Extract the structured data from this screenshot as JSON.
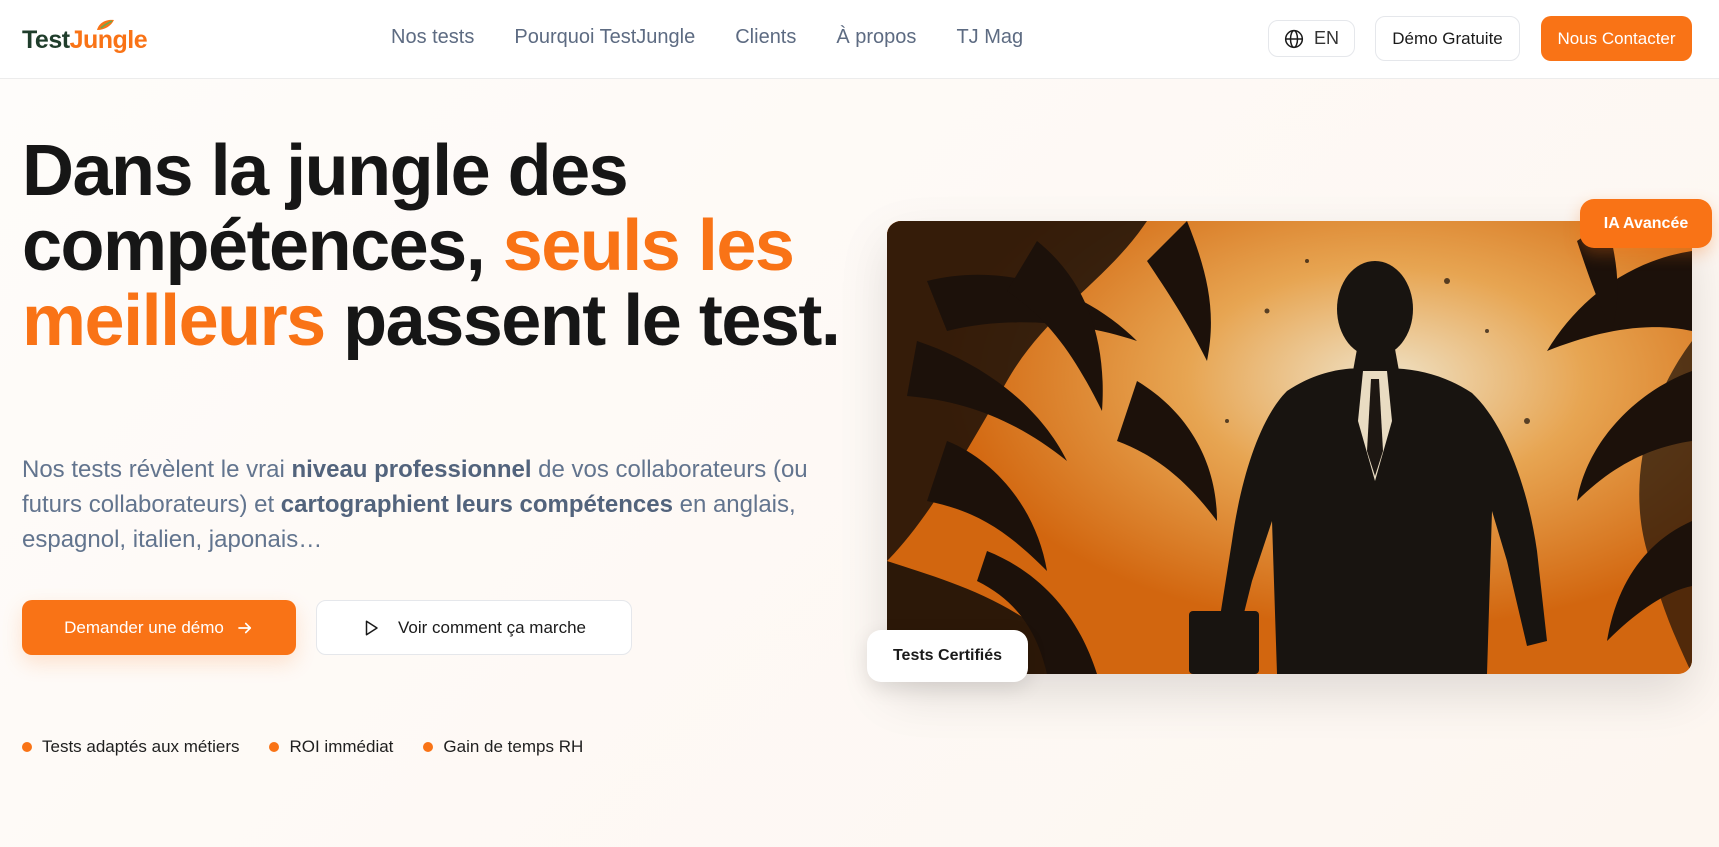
{
  "brand": {
    "logo_part1": "Test",
    "logo_part2": "Jungle",
    "accent_color": "#f97316"
  },
  "nav": {
    "items": [
      {
        "label": "Nos tests"
      },
      {
        "label": "Pourquoi TestJungle"
      },
      {
        "label": "Clients"
      },
      {
        "label": "À propos"
      },
      {
        "label": "TJ Mag"
      }
    ]
  },
  "header_actions": {
    "lang_label": "EN",
    "lang_icon": "globe-icon",
    "demo_label": "Démo Gratuite",
    "contact_label": "Nous Contacter"
  },
  "hero": {
    "title_part1": "Dans la jungle des compétences, ",
    "title_highlight": "seuls les meilleurs",
    "title_part2": " passent le test.",
    "sub_part1": "Nos tests révèlent le vrai ",
    "sub_bold1": "niveau professionnel",
    "sub_part2": " de vos collaborateurs (ou futurs collaborateurs) et ",
    "sub_bold2": "cartographient leurs compétences",
    "sub_part3": " en anglais, espagnol, italien, japonais…",
    "cta_primary": "Demander une démo",
    "cta_primary_icon": "arrow-right-icon",
    "cta_secondary": "Voir comment ça marche",
    "cta_secondary_icon": "play-icon"
  },
  "features": [
    {
      "label": "Tests adaptés aux métiers"
    },
    {
      "label": "ROI immédiat"
    },
    {
      "label": "Gain de temps RH"
    }
  ],
  "image_card": {
    "badge_top": "IA Avancée",
    "badge_bottom": "Tests Certifiés"
  }
}
